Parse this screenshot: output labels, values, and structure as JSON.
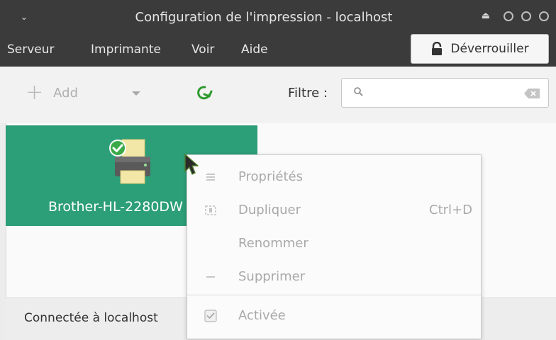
{
  "window": {
    "title": "Configuration de l'impression - localhost"
  },
  "menubar": {
    "items": [
      "Serveur",
      "Imprimante",
      "Voir",
      "Aide"
    ],
    "unlock_label": "Déverrouiller"
  },
  "toolbar": {
    "add_label": "Add",
    "filter_label": "Filtre :",
    "filter_value": "",
    "filter_placeholder": ""
  },
  "printers": [
    {
      "name": "Brother-HL-2280DW",
      "status": "default",
      "selected": true
    }
  ],
  "status": {
    "text": "Connectée à localhost"
  },
  "context_menu": {
    "items": [
      {
        "label": "Propriétés",
        "icon": "list-icon",
        "accel": ""
      },
      {
        "label": "Dupliquer",
        "icon": "duplicate-icon",
        "accel": "Ctrl+D"
      },
      {
        "label": "Renommer",
        "icon": "",
        "accel": ""
      },
      {
        "label": "Supprimer",
        "icon": "minus-icon",
        "accel": ""
      },
      {
        "label": "Activée",
        "icon": "checkbox-icon",
        "accel": "",
        "checked": true
      }
    ]
  },
  "colors": {
    "titlebar": "#3b3b3b",
    "selection": "#2c9e78",
    "refresh_icon": "#2e9a2e"
  }
}
